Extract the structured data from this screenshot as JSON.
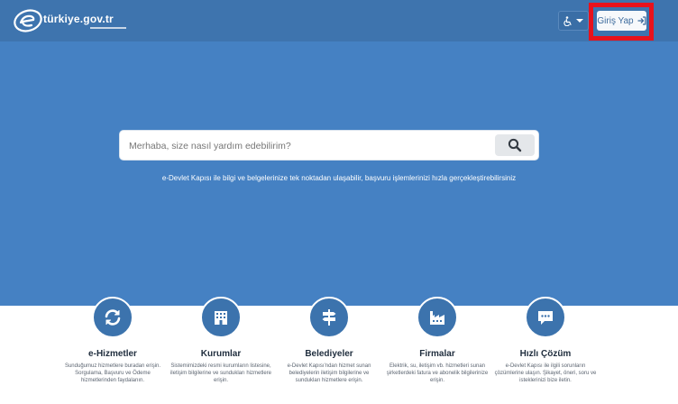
{
  "header": {
    "logo_text": "türkiye.gov.tr",
    "login_label": "Giriş Yap",
    "accessibility_icon": "wheelchair-icon",
    "login_icon": "sign-in-icon",
    "highlight_color": "#e8121c"
  },
  "hero": {
    "search_placeholder": "Merhaba, size nasıl yardım edebilirim?",
    "search_icon": "search-icon",
    "description": "e-Devlet Kapısı ile bilgi ve belgelerinize tek noktadan ulaşabilir, başvuru işlemlerinizi hızla gerçekleştirebilirsiniz"
  },
  "services": [
    {
      "title": "e-Hizmetler",
      "icon": "refresh-icon",
      "desc": "Sunduğumuz hizmetlere buradan erişin. Sorgulama, Başvuru ve Ödeme hizmetlerinden faydalanın."
    },
    {
      "title": "Kurumlar",
      "icon": "building-icon",
      "desc": "Sistemimizdeki resmi kurumların listesine, iletişim bilgilerine ve sundukları hizmetlere erişin."
    },
    {
      "title": "Belediyeler",
      "icon": "signpost-icon",
      "desc": "e-Devlet Kapısı'ndan hizmet sunan belediyelerin iletişim bilgilerine ve sundukları hizmetlere erişin."
    },
    {
      "title": "Firmalar",
      "icon": "factory-icon",
      "desc": "Elektrik, su, iletişim vb. hizmetleri sunan şirketlerdeki fatura ve abonelik bilgilerinize erişin."
    },
    {
      "title": "Hızlı Çözüm",
      "icon": "chat-icon",
      "desc": "e-Devlet Kapısı ile ilgili sorunların çözümlerine ulaşın. Şikayet, öneri, soru ve isteklerinizi bize iletin."
    }
  ],
  "colors": {
    "header_bg": "#3e74ae",
    "hero_bg": "#4581c3",
    "icon_circle": "#3c73ad"
  }
}
